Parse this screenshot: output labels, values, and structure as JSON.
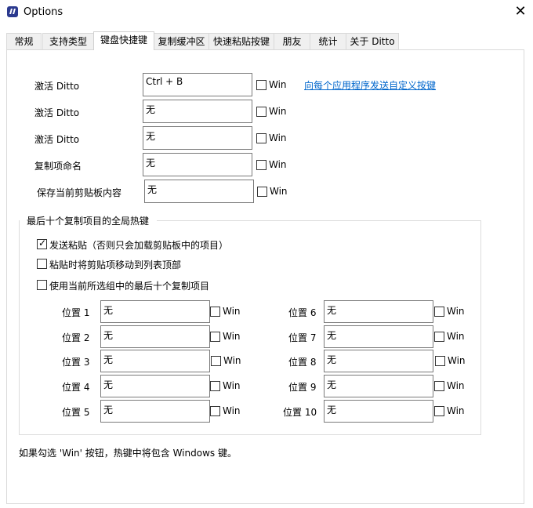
{
  "window": {
    "title": "Options",
    "close_glyph": "✕"
  },
  "tabs": [
    {
      "label": "常规"
    },
    {
      "label": "支持类型"
    },
    {
      "label": "键盘快捷键",
      "active": true
    },
    {
      "label": "复制缓冲区"
    },
    {
      "label": "快速粘贴按键"
    },
    {
      "label": "朋友"
    },
    {
      "label": "统计"
    },
    {
      "label": "关于 Ditto"
    }
  ],
  "hotkeys": [
    {
      "label": "激活 Ditto",
      "value": "Ctrl + B",
      "win_label": "Win",
      "win_checked": false
    },
    {
      "label": "激活 Ditto",
      "value": "无",
      "win_label": "Win",
      "win_checked": false
    },
    {
      "label": "激活 Ditto",
      "value": "无",
      "win_label": "Win",
      "win_checked": false
    },
    {
      "label": "复制项命名",
      "value": "无",
      "win_label": "Win",
      "win_checked": false
    },
    {
      "label": "保存当前剪贴板内容",
      "value": "无",
      "win_label": "Win",
      "win_checked": false
    }
  ],
  "send_custom_link": "向每个应用程序发送自定义按键",
  "group": {
    "title": "最后十个复制项目的全局热键",
    "options": [
      {
        "label": "发送粘贴（否则只会加载剪贴板中的项目）",
        "checked": true
      },
      {
        "label": "粘贴时将剪贴项移动到列表顶部",
        "checked": false
      },
      {
        "label": "使用当前所选组中的最后十个复制项目",
        "checked": false
      }
    ],
    "positions": [
      {
        "label": "位置 1",
        "value": "无",
        "win_label": "Win"
      },
      {
        "label": "位置 2",
        "value": "无",
        "win_label": "Win"
      },
      {
        "label": "位置 3",
        "value": "无",
        "win_label": "Win"
      },
      {
        "label": "位置 4",
        "value": "无",
        "win_label": "Win"
      },
      {
        "label": "位置 5",
        "value": "无",
        "win_label": "Win"
      },
      {
        "label": "位置 6",
        "value": "无",
        "win_label": "Win"
      },
      {
        "label": "位置 7",
        "value": "无",
        "win_label": "Win"
      },
      {
        "label": "位置 8",
        "value": "无",
        "win_label": "Win"
      },
      {
        "label": "位置 9",
        "value": "无",
        "win_label": "Win"
      },
      {
        "label": "位置 10",
        "value": "无",
        "win_label": "Win"
      }
    ]
  },
  "footer_note": "如果勾选 'Win' 按钮，热键中将包含 Windows 键。"
}
